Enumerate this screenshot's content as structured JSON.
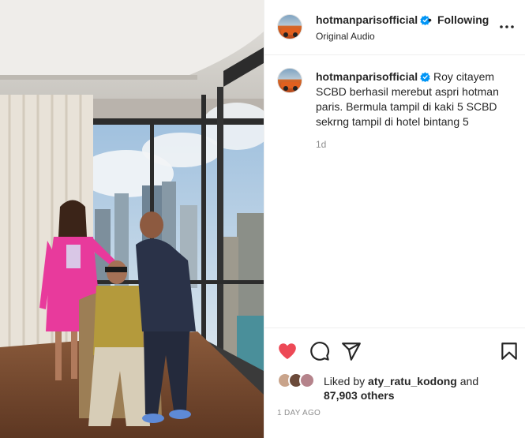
{
  "header": {
    "username": "hotmanparisofficial",
    "separator": "•",
    "follow_status": "Following",
    "audio_label": "Original Audio",
    "more_icon": "more-horizontal-icon"
  },
  "caption": {
    "username": "hotmanparisofficial",
    "text": "Roy citayem SCBD berhasil merebut aspri hotman paris. Bermula tampil di kaki 5 SCBD sekrng tampil di hotel bintang 5",
    "time": "1d"
  },
  "actions": {
    "like_icon": "heart-filled-icon",
    "comment_icon": "comment-icon",
    "share_icon": "share-icon",
    "save_icon": "bookmark-icon",
    "like_color": "#ed4956"
  },
  "likes": {
    "prefix": "Liked by",
    "user": "aty_ratu_kodong",
    "middle": "and",
    "count": "87,903 others"
  },
  "posted_ago": "1 DAY AGO",
  "colors": {
    "verified": "#0095f6",
    "text": "#262626",
    "muted": "#8e8e8e"
  }
}
